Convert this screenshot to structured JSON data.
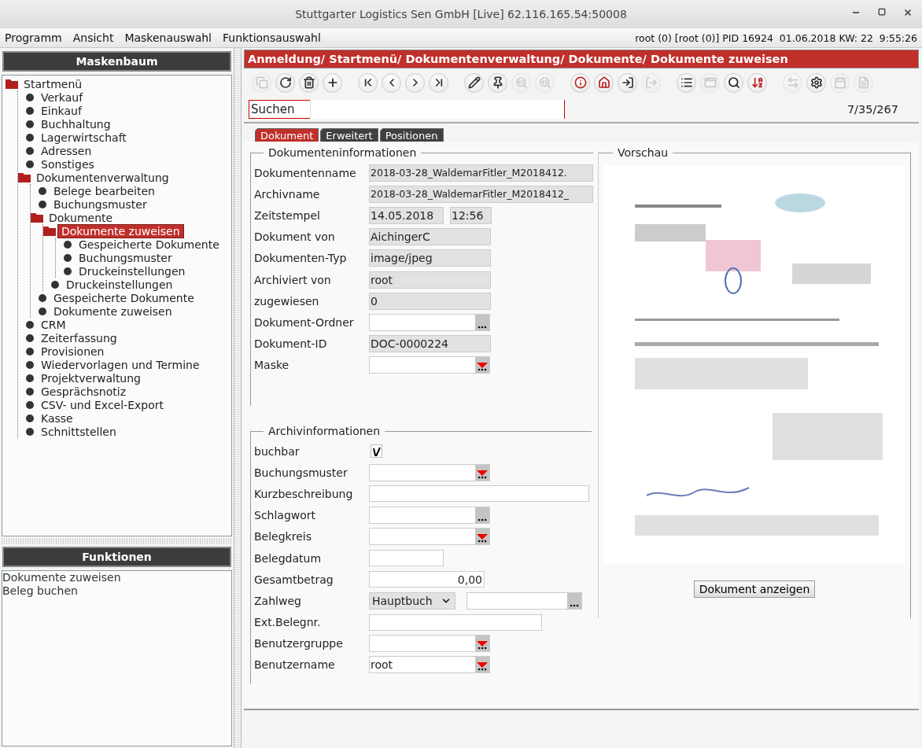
{
  "window": {
    "title": "Stuttgarter Logistics Sen GmbH [Live] 62.116.165.54:50008"
  },
  "menu": {
    "items": [
      "Programm",
      "Ansicht",
      "Maskenauswahl",
      "Funktionsauswahl"
    ],
    "status": "root (0) [root (0)] PID 16924  01.06.2018 KW: 22  9:55:26"
  },
  "tree_panel": {
    "title": "Maskenbaum",
    "items": [
      {
        "label": "Startmenü",
        "kind": "folder",
        "expanded": true,
        "selected": false,
        "children": [
          {
            "label": "Verkauf",
            "kind": "leaf",
            "selected": false
          },
          {
            "label": "Einkauf",
            "kind": "leaf",
            "selected": false
          },
          {
            "label": "Buchhaltung",
            "kind": "leaf",
            "selected": false
          },
          {
            "label": "Lagerwirtschaft",
            "kind": "leaf",
            "selected": false
          },
          {
            "label": "Adressen",
            "kind": "leaf",
            "selected": false
          },
          {
            "label": "Sonstiges",
            "kind": "leaf",
            "selected": false
          },
          {
            "label": "Dokumentenverwaltung",
            "kind": "folder",
            "expanded": true,
            "selected": false,
            "children": [
              {
                "label": "Belege bearbeiten",
                "kind": "leaf",
                "selected": false
              },
              {
                "label": "Buchungsmuster",
                "kind": "leaf",
                "selected": false
              },
              {
                "label": "Dokumente",
                "kind": "folder",
                "expanded": true,
                "selected": false,
                "children": [
                  {
                    "label": "Dokumente zuweisen",
                    "kind": "folder",
                    "expanded": true,
                    "selected": true,
                    "children": [
                      {
                        "label": "Gespeicherte Dokumente",
                        "kind": "leaf",
                        "selected": false
                      },
                      {
                        "label": "Buchungsmuster",
                        "kind": "leaf",
                        "selected": false
                      },
                      {
                        "label": "Druckeinstellungen",
                        "kind": "leaf",
                        "selected": false
                      }
                    ]
                  },
                  {
                    "label": "Druckeinstellungen",
                    "kind": "leaf",
                    "selected": false
                  }
                ]
              },
              {
                "label": "Gespeicherte Dokumente",
                "kind": "leaf",
                "selected": false
              },
              {
                "label": "Dokumente zuweisen",
                "kind": "leaf",
                "selected": false
              }
            ]
          },
          {
            "label": "CRM",
            "kind": "leaf",
            "selected": false
          },
          {
            "label": "Zeiterfassung",
            "kind": "leaf",
            "selected": false
          },
          {
            "label": "Provisionen",
            "kind": "leaf",
            "selected": false
          },
          {
            "label": "Wiedervorlagen und Termine",
            "kind": "leaf",
            "selected": false
          },
          {
            "label": "Projektverwaltung",
            "kind": "leaf",
            "selected": false
          },
          {
            "label": "Gesprächsnotiz",
            "kind": "leaf",
            "selected": false
          },
          {
            "label": "CSV- und Excel-Export",
            "kind": "leaf",
            "selected": false
          },
          {
            "label": "Kasse",
            "kind": "leaf",
            "selected": false
          },
          {
            "label": "Schnittstellen",
            "kind": "leaf",
            "selected": false
          }
        ]
      }
    ]
  },
  "functions_panel": {
    "title": "Funktionen",
    "items": [
      "Dokumente zuweisen",
      "Beleg buchen"
    ]
  },
  "breadcrumb": "Anmeldung/ Startmenü/ Dokumentenverwaltung/ Dokumente/ Dokumente zuweisen",
  "toolbar": [
    [
      {
        "kind": "window",
        "disabled": true
      },
      {
        "kind": "refresh",
        "disabled": false
      },
      {
        "kind": "delete",
        "disabled": false
      },
      {
        "kind": "add",
        "disabled": false
      }
    ],
    [
      {
        "kind": "first",
        "disabled": false
      },
      {
        "kind": "previous",
        "disabled": false
      },
      {
        "kind": "next",
        "disabled": false
      },
      {
        "kind": "last",
        "disabled": false
      }
    ],
    [
      {
        "kind": "edit",
        "disabled": false
      },
      {
        "kind": "pin",
        "disabled": false
      },
      {
        "kind": "find",
        "disabled": true
      },
      {
        "kind": "find",
        "disabled": true
      }
    ],
    [
      {
        "kind": "info",
        "disabled": false
      },
      {
        "kind": "home",
        "disabled": false
      },
      {
        "kind": "login",
        "disabled": false
      },
      {
        "kind": "logout",
        "disabled": true
      }
    ],
    [
      {
        "kind": "list",
        "disabled": false
      },
      {
        "kind": "form",
        "disabled": true
      },
      {
        "kind": "search",
        "disabled": false
      },
      {
        "kind": "sort",
        "disabled": false
      }
    ],
    [
      {
        "kind": "swap",
        "disabled": true
      },
      {
        "kind": "settings",
        "disabled": false
      },
      {
        "kind": "calendar",
        "disabled": true
      },
      {
        "kind": "document",
        "disabled": true
      }
    ]
  ],
  "search": {
    "label": "Suchen",
    "counter": "7/35/267"
  },
  "tabs": [
    {
      "label": "Dokument",
      "selected": true
    },
    {
      "label": "Erweitert",
      "selected": false
    },
    {
      "label": "Positionen",
      "selected": false
    }
  ],
  "document_info": {
    "title": "Dokumenteninformationen",
    "fields": [
      {
        "label": "Dokumentenname",
        "kind": "readonly_wide",
        "value": "2018-03-28_WaldemarFitler_M2018412."
      },
      {
        "label": "Archivname",
        "kind": "readonly_wide",
        "value": "2018-03-28_WaldemarFitler_M2018412_"
      },
      {
        "label": "Zeitstempel",
        "kind": "readonly_pair",
        "value": "14.05.2018",
        "value2": "12:56"
      },
      {
        "label": "Dokument von",
        "kind": "readonly",
        "value": "AichingerC"
      },
      {
        "label": "Dokumenten-Typ",
        "kind": "readonly",
        "value": "image/jpeg"
      },
      {
        "label": "Archiviert von",
        "kind": "readonly",
        "value": "root"
      },
      {
        "label": "zugewiesen",
        "kind": "readonly",
        "value": "0"
      },
      {
        "label": "Dokument-Ordner",
        "kind": "lookup"
      },
      {
        "label": "Dokument-ID",
        "kind": "readonly",
        "value": "DOC-0000224"
      },
      {
        "label": "Maske",
        "kind": "dropdown"
      }
    ]
  },
  "archive_info": {
    "title": "Archivinformationen",
    "fields": [
      {
        "label": "buchbar",
        "kind": "checkbox",
        "checked": true
      },
      {
        "label": "Buchungsmuster",
        "kind": "dropdown"
      },
      {
        "label": "Kurzbeschreibung",
        "kind": "input_wide"
      },
      {
        "label": "Schlagwort",
        "kind": "lookup"
      },
      {
        "label": "Belegkreis",
        "kind": "dropdown"
      },
      {
        "label": "Belegdatum",
        "kind": "input_short"
      },
      {
        "label": "Gesamtbetrag",
        "kind": "amount",
        "value": "0,00"
      },
      {
        "label": "Zahlweg",
        "kind": "combo_lookup",
        "value": "Hauptbuch"
      },
      {
        "label": "Ext.Belegnr.",
        "kind": "input_medium"
      },
      {
        "label": "Benutzergruppe",
        "kind": "dropdown"
      },
      {
        "label": "Benutzername",
        "kind": "dropdown",
        "value": "root"
      }
    ]
  },
  "preview": {
    "title": "Vorschau",
    "button": "Dokument anzeigen"
  }
}
